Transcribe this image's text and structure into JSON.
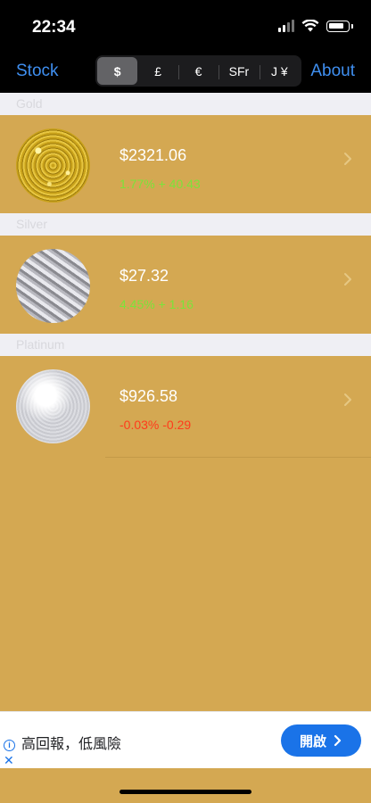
{
  "status_bar": {
    "time": "22:34"
  },
  "nav": {
    "left_label": "Stock",
    "right_label": "About",
    "currency_segments": [
      "$",
      "£",
      "€",
      "SFr",
      "J ¥"
    ],
    "selected_segment": "$"
  },
  "metals": [
    {
      "section": "Gold",
      "price": "$2321.06",
      "change": "1.77% + 40.43",
      "direction": "up"
    },
    {
      "section": "Silver",
      "price": "$27.32",
      "change": "4.45% + 1.16",
      "direction": "up"
    },
    {
      "section": "Platinum",
      "price": "$926.58",
      "change": "-0.03% -0.29",
      "direction": "down"
    }
  ],
  "ad": {
    "text": "高回報，低風險",
    "cta_label": "開啟"
  },
  "colors": {
    "background": "#d4a852",
    "accent": "#3f8ff0",
    "positive": "#7be33a",
    "negative": "#ff3b1c",
    "ad_cta": "#1a73e8"
  }
}
